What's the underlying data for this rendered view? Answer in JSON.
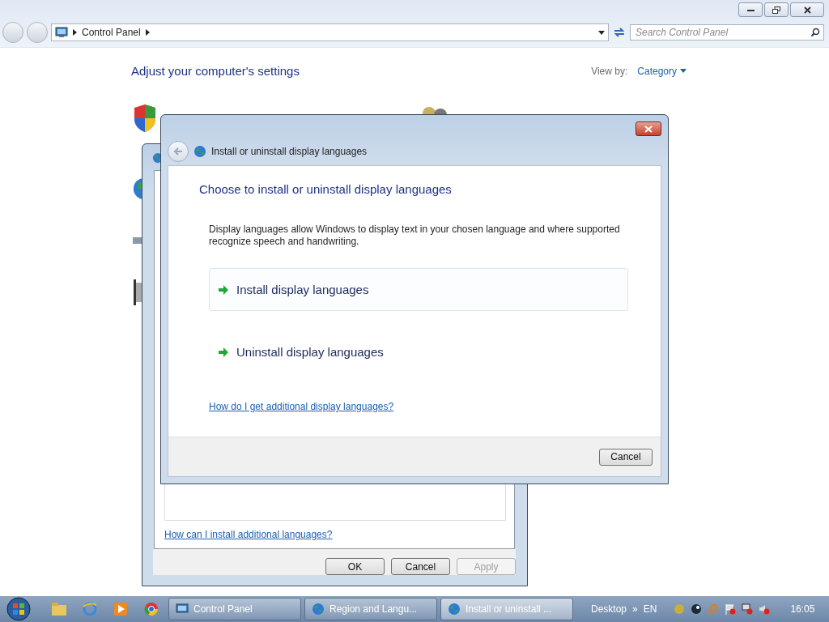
{
  "explorer": {
    "address": [
      "Control Panel"
    ],
    "search": {
      "placeholder": "Search Control Panel"
    },
    "heading": "Adjust your computer's settings",
    "view_by_label": "View by:",
    "view_by_value": "Category"
  },
  "region_dialog": {
    "help_link": "How can I install additional languages?",
    "buttons": [
      {
        "label": "OK",
        "disabled": false
      },
      {
        "label": "Cancel",
        "disabled": false
      },
      {
        "label": "Apply",
        "disabled": true
      }
    ]
  },
  "language_dialog": {
    "title": "Install or uninstall display languages",
    "heading": "Choose to install or uninstall display languages",
    "description": "Display languages allow Windows to display text in your chosen language and where supported recognize speech and handwriting.",
    "options": [
      {
        "label": "Install display languages",
        "selected": true
      },
      {
        "label": "Uninstall display languages",
        "selected": false
      }
    ],
    "help_link": "How do I get additional display languages?",
    "buttons": [
      "Cancel"
    ]
  },
  "taskbar": {
    "tasks": [
      {
        "label": "Control Panel",
        "selected": false
      },
      {
        "label": "Region and Langu...",
        "selected": false
      },
      {
        "label": "Install or uninstall ...",
        "selected": true
      }
    ],
    "desktop_label": "Desktop",
    "chevron": "»",
    "language": "EN",
    "clock": "16:05"
  }
}
